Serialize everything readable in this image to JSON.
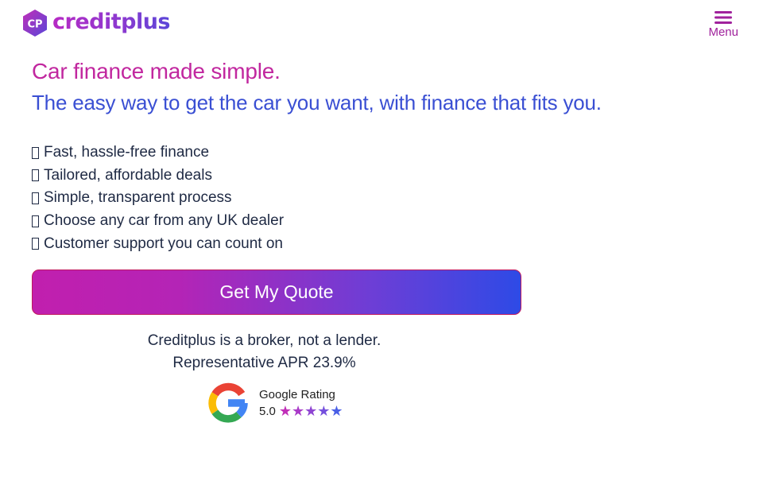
{
  "header": {
    "logo_text": "creditplus",
    "logo_mark": "CP",
    "menu_label": "Menu",
    "menu_icon": "hamburger-icon"
  },
  "hero": {
    "headline": "Car finance made simple.",
    "subheadline": "The easy way to get the car you want, with finance that fits you."
  },
  "benefits": [
    "Fast, hassle-free finance",
    "Tailored, affordable deals",
    "Simple, transparent process",
    "Choose any car from any UK dealer",
    "Customer support you can count on"
  ],
  "cta": {
    "label": "Get My Quote"
  },
  "disclaimer": {
    "line1": "Creditplus is a broker, not a lender.",
    "line2": "Representative APR 23.9%"
  },
  "rating": {
    "label": "Google Rating",
    "score": "5.0",
    "stars": 5,
    "star_colors": [
      "#c02fb8",
      "#a93ac8",
      "#8f45d2",
      "#7550dd",
      "#4a5fe6"
    ]
  },
  "colors": {
    "brand_pink": "#c1279f",
    "brand_blue": "#3a4fd3",
    "text_dark": "#1f2a44",
    "cta_start": "#c11fae",
    "cta_end": "#2e4ae6"
  }
}
